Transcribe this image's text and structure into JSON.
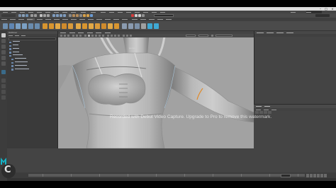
{
  "window": {
    "title": ""
  },
  "shelf_tabs": [
    "",
    "",
    "",
    "",
    "",
    "",
    "",
    "",
    "",
    "",
    "",
    "",
    "",
    "",
    "",
    "",
    "",
    "",
    "",
    ""
  ],
  "outliner": {
    "title": "Outliner"
  },
  "viewport": {
    "camera_label": "persp"
  },
  "watermark": {
    "text": "Recorded with Debut Video Capture. Upgrade to Pro to remove this watermark."
  },
  "colors": {
    "viewport_bg": "#a2a2a2",
    "panel_bg": "#444444",
    "titlebar_bg": "#dcdcdc",
    "shelf_icons_accent": "#e4a23a",
    "maya_logo": "#13b5c9"
  },
  "icons": {
    "maya_logo": "maya-logo-icon",
    "recorder_logo": "recorder-logo-icon"
  }
}
